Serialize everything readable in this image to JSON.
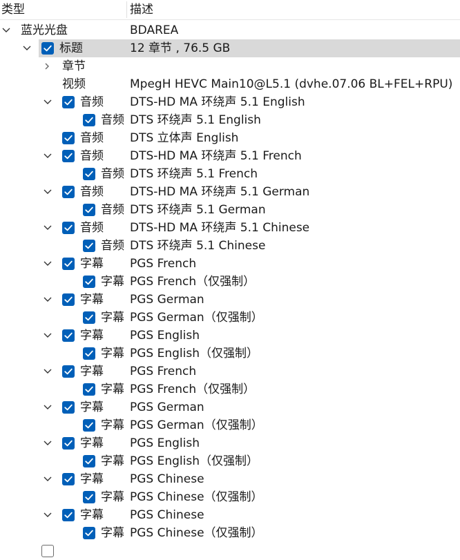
{
  "header": {
    "type_label": "类型",
    "desc_label": "描述"
  },
  "rows": [
    {
      "type": "蓝光光盘",
      "desc": "BDAREA"
    },
    {
      "type": "标题",
      "desc": "12 章节 , 76.5 GB"
    },
    {
      "type": "章节",
      "desc": ""
    },
    {
      "type": "视频",
      "desc": "MpegH HEVC Main10@L5.1 (dvhe.07.06 BL+FEL+RPU)"
    },
    {
      "type": "音频",
      "desc": "DTS-HD MA 环绕声 5.1 English"
    },
    {
      "type": "音频",
      "desc": "DTS 环绕声 5.1 English"
    },
    {
      "type": "音频",
      "desc": "DTS 立体声 English"
    },
    {
      "type": "音频",
      "desc": "DTS-HD MA 环绕声 5.1 French"
    },
    {
      "type": "音频",
      "desc": "DTS 环绕声 5.1 French"
    },
    {
      "type": "音频",
      "desc": "DTS-HD MA 环绕声 5.1 German"
    },
    {
      "type": "音频",
      "desc": "DTS 环绕声 5.1 German"
    },
    {
      "type": "音频",
      "desc": "DTS-HD MA 环绕声 5.1 Chinese"
    },
    {
      "type": "音频",
      "desc": "DTS 环绕声 5.1 Chinese"
    },
    {
      "type": "字幕",
      "desc": "PGS French"
    },
    {
      "type": "字幕",
      "desc": "PGS French（仅强制）"
    },
    {
      "type": "字幕",
      "desc": "PGS German"
    },
    {
      "type": "字幕",
      "desc": "PGS German（仅强制）"
    },
    {
      "type": "字幕",
      "desc": "PGS English"
    },
    {
      "type": "字幕",
      "desc": "PGS English（仅强制）"
    },
    {
      "type": "字幕",
      "desc": "PGS French"
    },
    {
      "type": "字幕",
      "desc": "PGS French（仅强制）"
    },
    {
      "type": "字幕",
      "desc": "PGS German"
    },
    {
      "type": "字幕",
      "desc": "PGS German（仅强制）"
    },
    {
      "type": "字幕",
      "desc": "PGS English"
    },
    {
      "type": "字幕",
      "desc": "PGS English（仅强制）"
    },
    {
      "type": "字幕",
      "desc": "PGS Chinese"
    },
    {
      "type": "字幕",
      "desc": "PGS Chinese（仅强制）"
    },
    {
      "type": "字幕",
      "desc": "PGS Chinese"
    },
    {
      "type": "字幕",
      "desc": "PGS Chinese（仅强制）"
    }
  ],
  "colors": {
    "checkbox": "#005fb8",
    "selected_row": "#d9d9d9"
  },
  "icons": {
    "expanded": "chevron-down-icon",
    "collapsed": "chevron-right-icon",
    "checked": "checkbox-checked-icon"
  }
}
